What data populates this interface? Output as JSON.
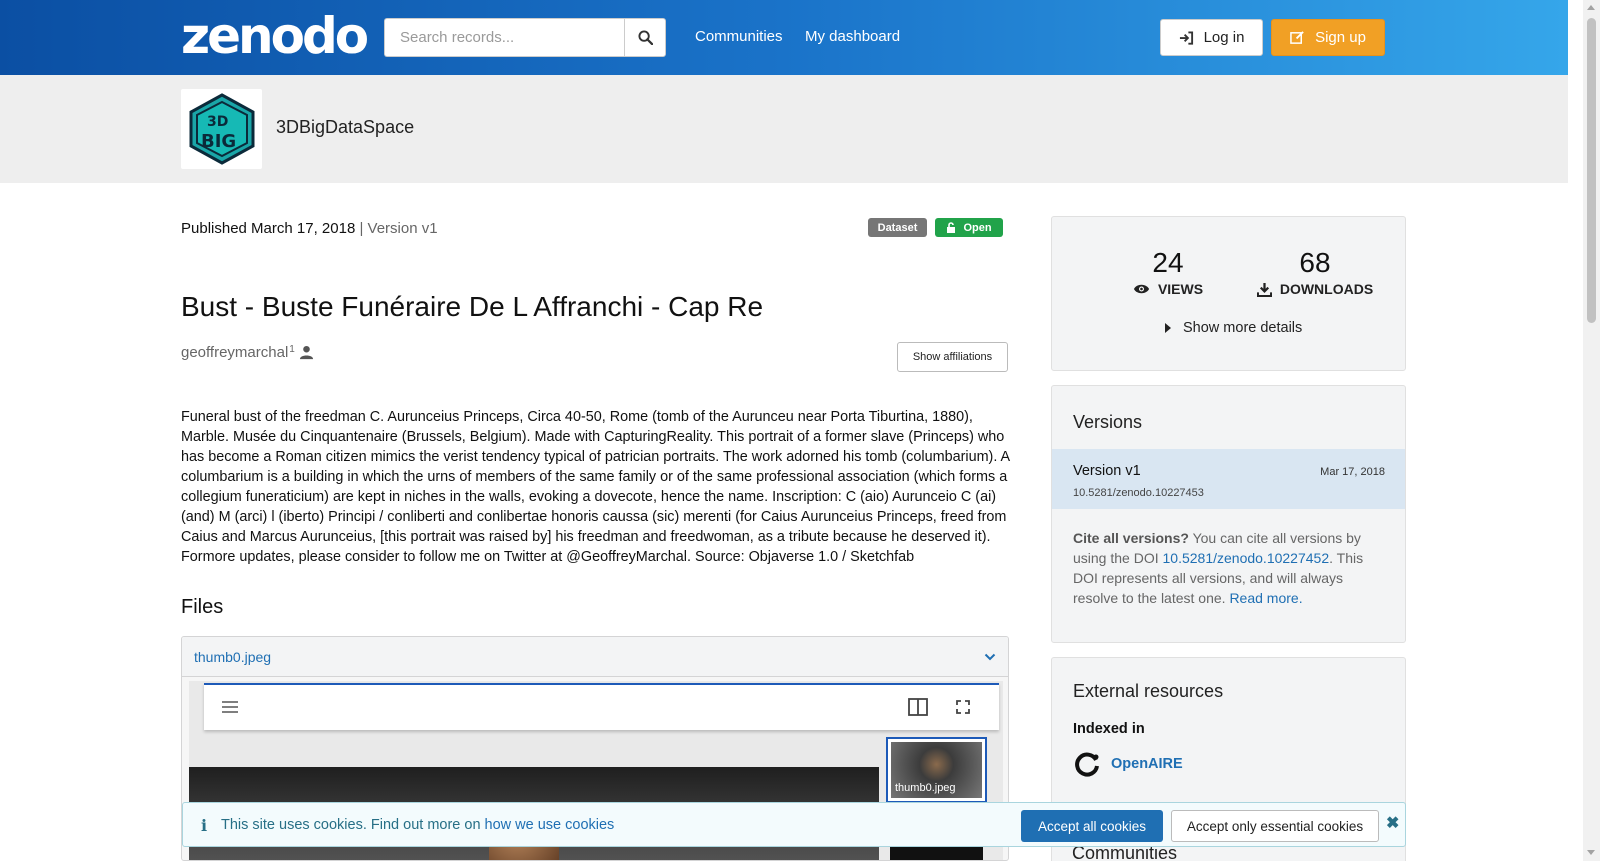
{
  "header": {
    "logo": "zenodo",
    "search_placeholder": "Search records...",
    "nav": [
      "Communities",
      "My dashboard"
    ],
    "login_label": "Log in",
    "signup_label": "Sign up"
  },
  "community": {
    "name": "3DBigDataSpace",
    "logo_text": "3D BIG DATA SPACE"
  },
  "record": {
    "published": "Published March 17, 2018",
    "version": "| Version v1",
    "badges": {
      "type": "Dataset",
      "access": "Open"
    },
    "title": "Bust - Buste Funéraire De L Affranchi - Cap Re",
    "creator": "geoffreymarchal",
    "creator_sup": "1",
    "affiliations_button": "Show affiliations",
    "description": "Funeral bust of the freedman C. Aurunceius Princeps, Circa 40-50, Rome (tomb of the Aurunceu near Porta Tiburtina, 1880), Marble. Musée du Cinquantenaire (Brussels, Belgium). Made with CapturingReality. This portrait of a former slave (Princeps) who has become a Roman citizen mimics the verist tendency typical of patrician portraits. The work adorned his tomb (columbarium). A columbarium is a building in which the urns of members of the same family or of the same professional association (which forms a collegium funeraticium) are kept in niches in the walls, evoking a dovecote, hence the name. Inscription: C (aio) Aurunceio C (ai) (and) M (arci) l (iberto) Principi / conliberti and conlibertae honoris caussa (sic) merenti (for Caius Aurunceius Princeps, freed from Caius and Marcus Aurunceius, [this portrait was raised by] his freedman and freedwoman, as a tribute because he deserved it). Formore updates, please consider to follow me on Twitter at @GeoffreyMarchal. Source: Objaverse 1.0 / Sketchfab"
  },
  "files": {
    "heading": "Files",
    "file_name": "thumb0.jpeg",
    "thumb_label": "thumb0.jpeg"
  },
  "stats": {
    "views": "24",
    "views_label": "VIEWS",
    "downloads": "68",
    "downloads_label": "DOWNLOADS",
    "more_details": "Show more details"
  },
  "versions": {
    "title": "Versions",
    "item": {
      "name": "Version v1",
      "date": "Mar 17, 2018",
      "doi": "10.5281/zenodo.10227453"
    },
    "cite_bold": "Cite all versions?",
    "cite_pre": " You can cite all versions by using the DOI ",
    "cite_doi": "10.5281/zenodo.10227452",
    "cite_post": ". This DOI represents all versions, and will always resolve to the latest one. ",
    "read_more": "Read more."
  },
  "external": {
    "title": "External resources",
    "indexed_in": "Indexed in",
    "openaire": "OpenAIRE",
    "communities_title": "Communities"
  },
  "cookie": {
    "text": "This site uses cookies. Find out more on ",
    "link": "how we use cookies",
    "accept_all": "Accept all cookies",
    "accept_essential": "Accept only essential cookies"
  },
  "colors": {
    "header_start": "#0b4fa3",
    "header_end": "#35a6ea",
    "signup": "#f1a025",
    "open_badge": "#21a34a",
    "link": "#1f6fb3"
  }
}
